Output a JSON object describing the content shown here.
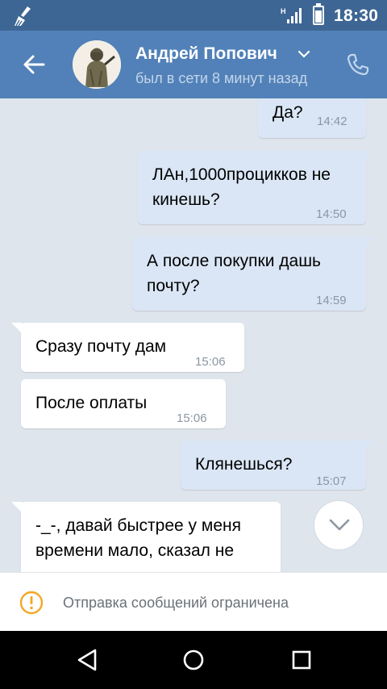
{
  "status_bar": {
    "network": "H",
    "time": "18:30",
    "battery_level": 0.75
  },
  "header": {
    "contact_name": "Андрей Попович",
    "last_seen": "был в сети 8 минут назад",
    "icons": [
      "back-arrow-icon",
      "chevron-down-icon",
      "phone-icon"
    ]
  },
  "messages": [
    {
      "direction": "out",
      "text": "Да?",
      "time": "14:42"
    },
    {
      "direction": "out",
      "text": "ЛАн,1000процикков не кинешь?",
      "time": "14:50"
    },
    {
      "direction": "out",
      "text": "А после покупки дашь почту?",
      "time": "14:59"
    },
    {
      "direction": "in",
      "text": "Сразу почту дам",
      "time": "15:06"
    },
    {
      "direction": "in",
      "text": "После оплаты",
      "time": "15:06"
    },
    {
      "direction": "out",
      "text": "Клянешься?",
      "time": "15:07"
    },
    {
      "direction": "in",
      "text": "-_-, давай быстрее у меня времени мало, сказал не",
      "time": ""
    }
  ],
  "notice": {
    "text": "Отправка сообщений ограничена",
    "color": "#f5a623"
  },
  "colors": {
    "status_bar": "#3e6694",
    "header": "#5181b8",
    "outgoing_bubble": "#dae6f5",
    "incoming_bubble": "#ffffff",
    "chat_background": "#dfe5ec"
  }
}
